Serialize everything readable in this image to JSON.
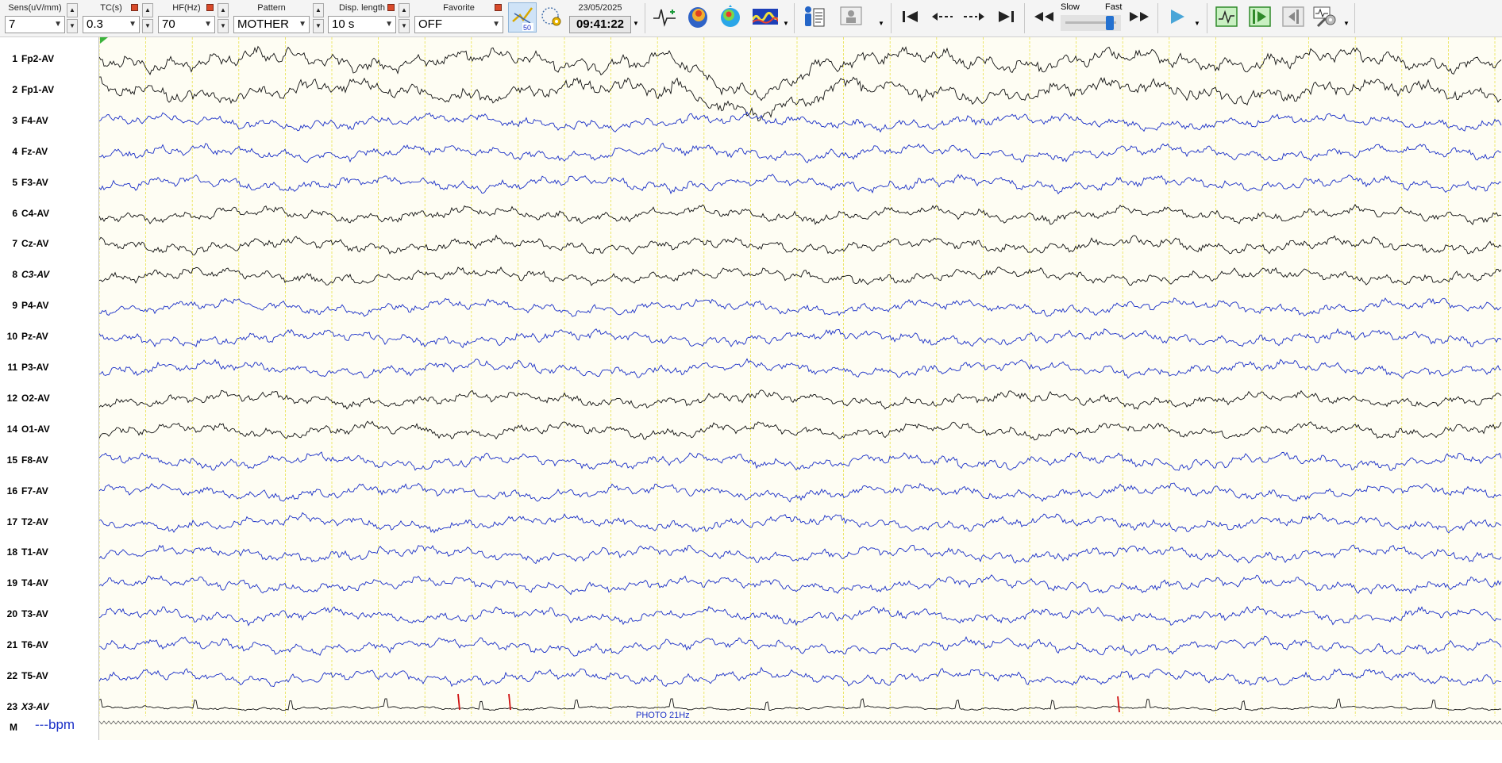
{
  "toolbar": {
    "sens": {
      "label": "Sens(uV/mm)",
      "value": "7"
    },
    "tc": {
      "label": "TC(s)",
      "value": "0.3"
    },
    "hf": {
      "label": "HF(Hz)",
      "value": "70"
    },
    "pattern": {
      "label": "Pattern",
      "value": "MOTHER"
    },
    "disp_length": {
      "label": "Disp. length",
      "value": "10 s"
    },
    "favorite": {
      "label": "Favorite",
      "value": "OFF"
    },
    "notch_badge": "50",
    "date": "23/05/2025",
    "time": "09:41:22",
    "speed": {
      "slow_label": "Slow",
      "fast_label": "Fast",
      "level": 0.85
    },
    "icons": [
      "annotation-wave-icon",
      "head-3d-icon",
      "topographic-map-icon",
      "spectrum-icon",
      "patient-info-icon",
      "report-icon",
      "go-start-icon",
      "step-back-icon",
      "step-forward-icon",
      "go-end-icon",
      "rewind-icon",
      "fast-forward-icon",
      "play-icon",
      "montage-view-icon",
      "video-play-icon",
      "collapse-icon",
      "tools-settings-icon"
    ]
  },
  "channels": [
    {
      "num": "1",
      "name": "Fp2-AV",
      "color": "#111111"
    },
    {
      "num": "2",
      "name": "Fp1-AV",
      "color": "#111111"
    },
    {
      "num": "3",
      "name": "F4-AV",
      "color": "#1a2fc7"
    },
    {
      "num": "4",
      "name": "Fz-AV",
      "color": "#1a2fc7"
    },
    {
      "num": "5",
      "name": "F3-AV",
      "color": "#1a2fc7"
    },
    {
      "num": "6",
      "name": "C4-AV",
      "color": "#111111"
    },
    {
      "num": "7",
      "name": "Cz-AV",
      "color": "#111111"
    },
    {
      "num": "8",
      "name": "C3-AV",
      "color": "#111111",
      "italic": true
    },
    {
      "num": "9",
      "name": "P4-AV",
      "color": "#1a2fc7"
    },
    {
      "num": "10",
      "name": "Pz-AV",
      "color": "#1a2fc7"
    },
    {
      "num": "11",
      "name": "P3-AV",
      "color": "#1a2fc7"
    },
    {
      "num": "12",
      "name": "O2-AV",
      "color": "#111111"
    },
    {
      "num": "14",
      "name": "O1-AV",
      "color": "#111111"
    },
    {
      "num": "15",
      "name": "F8-AV",
      "color": "#1a2fc7"
    },
    {
      "num": "16",
      "name": "F7-AV",
      "color": "#1a2fc7"
    },
    {
      "num": "17",
      "name": "T2-AV",
      "color": "#1a2fc7"
    },
    {
      "num": "18",
      "name": "T1-AV",
      "color": "#1a2fc7"
    },
    {
      "num": "19",
      "name": "T4-AV",
      "color": "#1a2fc7"
    },
    {
      "num": "20",
      "name": "T3-AV",
      "color": "#1a2fc7"
    },
    {
      "num": "21",
      "name": "T6-AV",
      "color": "#1a2fc7"
    },
    {
      "num": "22",
      "name": "T5-AV",
      "color": "#1a2fc7"
    },
    {
      "num": "23",
      "name": "X3-AV",
      "color": "#111111",
      "italic": true
    }
  ],
  "marker_row": {
    "num": "M",
    "bpm": "---bpm"
  },
  "annotation": "PHOTO 21Hz",
  "colors": {
    "trace_bg": "#fefdf3",
    "grid": "#e8e04a",
    "accent_marker": "#d01010",
    "blue": "#1a2fc7"
  }
}
